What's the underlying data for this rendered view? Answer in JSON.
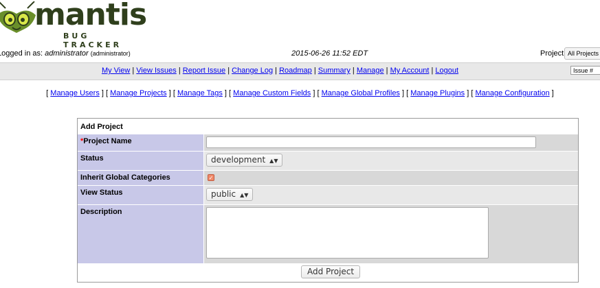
{
  "logo": {
    "word": "mantis",
    "sub": "BUG TRACKER"
  },
  "login": {
    "prefix": "Logged in as: ",
    "user": "administrator",
    "role": "(administrator)"
  },
  "datetime": "2015-06-26 11:52 EDT",
  "project": {
    "label": "Project:",
    "selected": "All Projects"
  },
  "menu": {
    "items": [
      "My View",
      "View Issues",
      "Report Issue",
      "Change Log",
      "Roadmap",
      "Summary",
      "Manage",
      "My Account",
      "Logout"
    ],
    "separator": " | ",
    "issue_placeholder": "Issue #"
  },
  "manage_menu": {
    "items": [
      "Manage Users",
      "Manage Projects",
      "Manage Tags",
      "Manage Custom Fields",
      "Manage Global Profiles",
      "Manage Plugins",
      "Manage Configuration"
    ],
    "open": "[ ",
    "close": " ]"
  },
  "form": {
    "title": "Add Project",
    "required_mark": "*",
    "project_name_label": "Project Name",
    "project_name_value": "",
    "status_label": "Status",
    "status_value": "development",
    "inherit_label": "Inherit Global Categories",
    "inherit_checked": true,
    "view_status_label": "View Status",
    "view_status_value": "public",
    "description_label": "Description",
    "description_value": "",
    "submit_label": "Add Project"
  },
  "colors": {
    "category_bg": "#c8c8e8",
    "value_bg": "#d8d8d8",
    "link": "#0000ee",
    "required": "#ff0000"
  }
}
